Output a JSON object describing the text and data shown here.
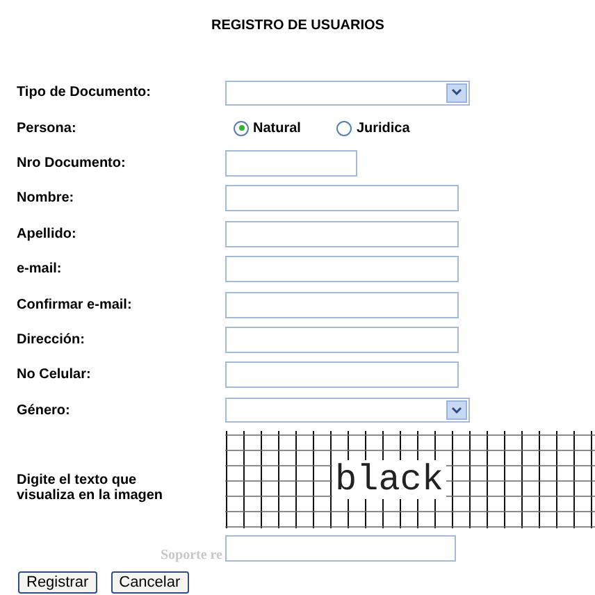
{
  "title": "REGISTRO DE USUARIOS",
  "fields": [
    {
      "label": "Tipo de Documento:",
      "kind": "select"
    },
    {
      "label": "Persona:",
      "kind": "radio",
      "options": [
        {
          "label": "Natural",
          "selected": true
        },
        {
          "label": "Juridica",
          "selected": false
        }
      ]
    },
    {
      "label": "Nro Documento:",
      "kind": "short"
    },
    {
      "label": "Nombre:",
      "kind": "text"
    },
    {
      "label": "Apellido:",
      "kind": "text"
    },
    {
      "label": "e-mail:",
      "kind": "text"
    },
    {
      "label": "Confirmar e-mail:",
      "kind": "text"
    },
    {
      "label": "Dirección:",
      "kind": "text"
    },
    {
      "label": "No Celular:",
      "kind": "text"
    },
    {
      "label": "Género:",
      "kind": "select"
    }
  ],
  "captcha": {
    "label": "Digite el texto que visualiza en la imagen",
    "text": "black",
    "note": "Soporte re"
  },
  "buttons": [
    "Registrar",
    "Cancelar"
  ]
}
